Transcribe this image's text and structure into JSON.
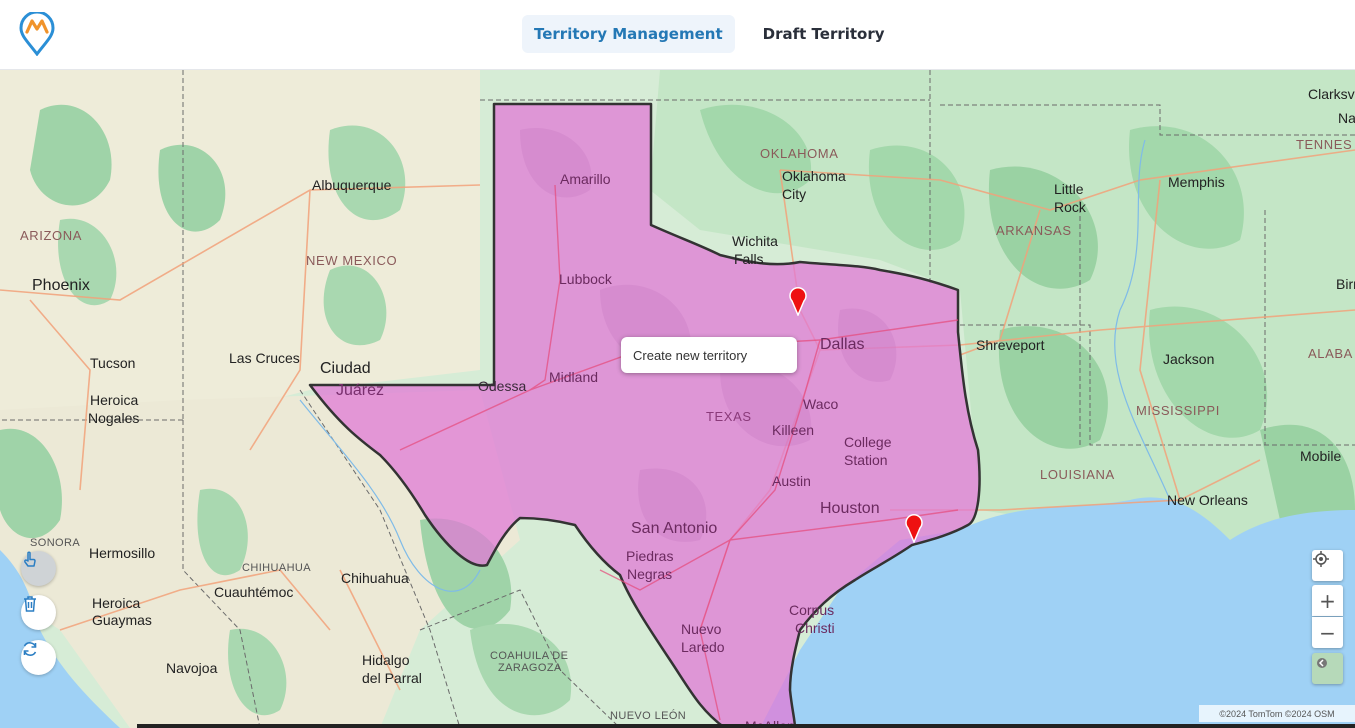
{
  "header": {
    "tabs": [
      {
        "label": "Territory Management",
        "active": true
      },
      {
        "label": "Draft Territory",
        "active": false
      }
    ]
  },
  "map": {
    "popup_label": "Create new territory",
    "territory_color": "#e07ad6",
    "cities": [
      "Albuquerque",
      "Phoenix",
      "Tucson",
      "Las Cruces",
      "Ciudad",
      "Juárez",
      "Heroica",
      "Nogales",
      "Hermosillo",
      "Cuauhtémoc",
      "Chihuahua",
      "Heroica",
      "Guaymas",
      "Navojoa",
      "Hidalgo",
      "del Parral",
      "Amarillo",
      "Lubbock",
      "Odessa",
      "Midland",
      "Wichita",
      "Falls",
      "Oklahoma",
      "City",
      "Dallas",
      "Waco",
      "Killeen",
      "College",
      "Station",
      "Austin",
      "Houston",
      "San Antonio",
      "Piedras",
      "Negras",
      "Nuevo",
      "Laredo",
      "Corpus",
      "Christi",
      "McAllen",
      "Little",
      "Rock",
      "Memphis",
      "Shreveport",
      "Jackson",
      "Mobile",
      "New Orleans",
      "Clarksv",
      "Na",
      "Birr"
    ],
    "states": [
      "ARIZONA",
      "NEW MEXICO",
      "OKLAHOMA",
      "ARKANSAS",
      "TEXAS",
      "LOUISIANA",
      "MISSISSIPPI",
      "TENNES",
      "ALABA",
      "SONORA",
      "CHIHUAHUA",
      "COAHUILA DE",
      "ZARAGOZA",
      "NUEVO LEÓN"
    ],
    "attribution": "©2024 TomTom ©2024 OSM"
  },
  "icons": {
    "logo": "map-pin-logo-icon",
    "draw": "hand-pointer-icon",
    "delete": "trash-icon",
    "refresh": "refresh-icon",
    "locate": "crosshair-icon",
    "zoom_in": "plus-icon",
    "zoom_out": "minus-icon",
    "layers": "map-layers-icon"
  }
}
